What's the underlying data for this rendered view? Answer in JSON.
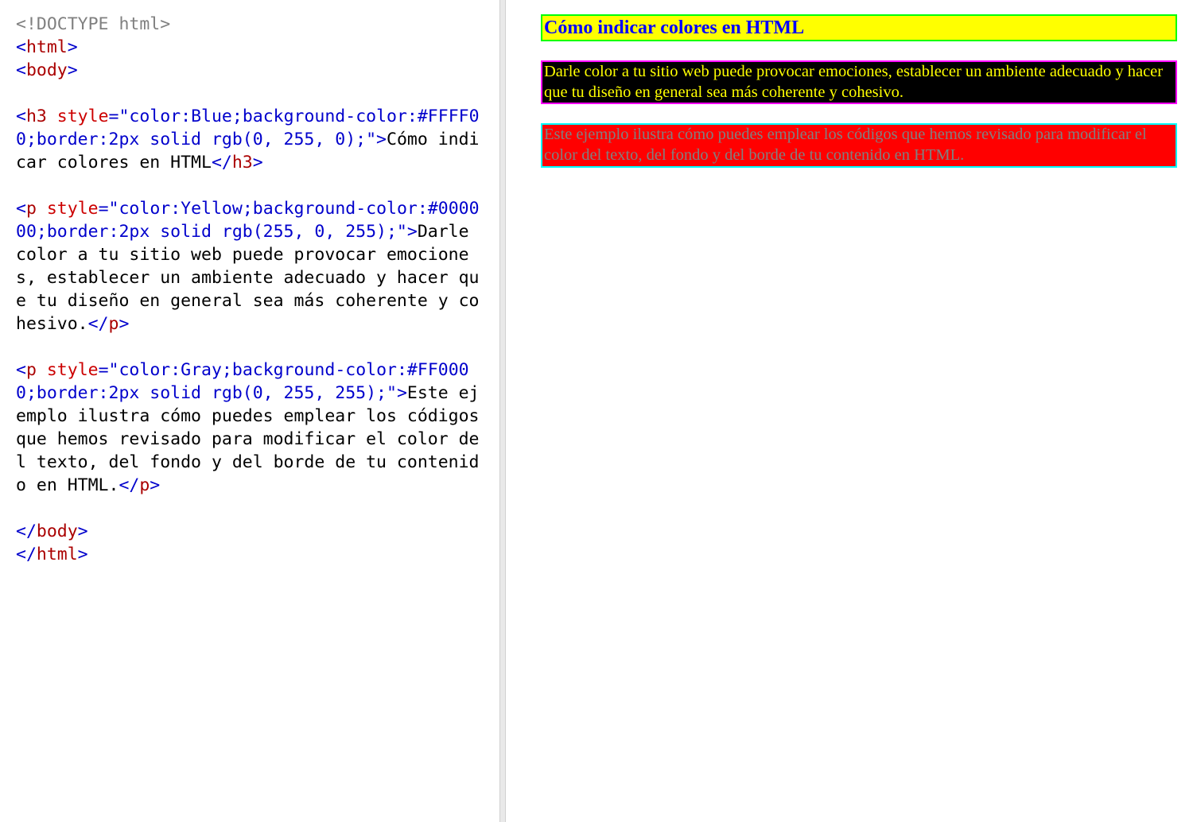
{
  "code": {
    "doctype": "<!DOCTYPE html>",
    "html_open_lt": "<",
    "html_open_name": "html",
    "html_open_gt": ">",
    "body_open_lt": "<",
    "body_open_name": "body",
    "body_open_gt": ">",
    "h3_lt": "<",
    "h3_name": "h3",
    "h3_space": " ",
    "h3_attr": "style",
    "h3_eq": "=",
    "h3_val": "\"color:Blue;background-color:#FFFF00;border:2px solid rgb(0, 255, 0);\"",
    "h3_gt": ">",
    "h3_text": "Cómo indicar colores en HTML",
    "h3_close": "</",
    "h3_close_name": "h3",
    "h3_close_gt": ">",
    "p1_lt": "<",
    "p1_name": "p",
    "p1_space": " ",
    "p1_attr": "style",
    "p1_eq": "=",
    "p1_val": "\"color:Yellow;background-color:#000000;border:2px solid rgb(255, 0, 255);\"",
    "p1_gt": ">",
    "p1_text": "Darle color a tu sitio web puede provocar emociones, establecer un ambiente adecuado y hacer que tu diseño en general sea más coherente y cohesivo.",
    "p1_close": "</",
    "p1_close_name": "p",
    "p1_close_gt": ">",
    "p2_lt": "<",
    "p2_name": "p",
    "p2_space": " ",
    "p2_attr": "style",
    "p2_eq": "=",
    "p2_val": "\"color:Gray;background-color:#FF0000;border:2px solid rgb(0, 255, 255);\"",
    "p2_gt": ">",
    "p2_text": "Este ejemplo ilustra cómo puedes emplear los códigos que hemos revisado para modificar el color del texto, del fondo y del borde de tu contenido en HTML.",
    "p2_close": "</",
    "p2_close_name": "p",
    "p2_close_gt": ">",
    "body_close": "</",
    "body_close_name": "body",
    "body_close_gt": ">",
    "html_close": "</",
    "html_close_name": "html",
    "html_close_gt": ">"
  },
  "preview": {
    "heading": "Cómo indicar colores en HTML",
    "para1": "Darle color a tu sitio web puede provocar emociones, establecer un ambiente adecuado y hacer que tu diseño en general sea más coherente y cohesivo.",
    "para2": "Este ejemplo ilustra cómo puedes emplear los códigos que hemos revisado para modificar el color del texto, del fondo y del borde de tu contenido en HTML."
  }
}
